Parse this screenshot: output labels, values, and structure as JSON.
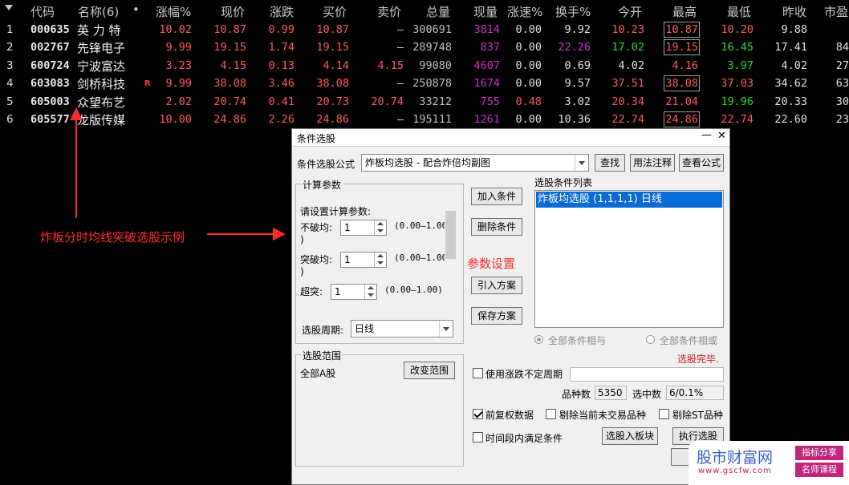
{
  "table": {
    "headers": {
      "code": "代码",
      "name": "名称(6)",
      "change_pct": "涨幅%",
      "price": "现价",
      "change": "涨跌",
      "bid": "买价",
      "ask": "卖价",
      "volume": "总量",
      "cur_volume": "现量",
      "speed": "涨速%",
      "turnover": "换手%",
      "open": "今开",
      "high": "最高",
      "low": "最低",
      "prev_close": "昨收",
      "mcap": "市盈"
    },
    "header_dot": "•",
    "rows": [
      {
        "idx": "1",
        "code": "000635",
        "name": "英 力 特",
        "flag": "",
        "change_pct": "10.02",
        "price": "10.87",
        "change": "0.99",
        "bid": "10.87",
        "ask": "–",
        "volume": "300691",
        "cur_volume": "3814",
        "speed": "0.00",
        "turnover": "9.92",
        "open": "10.23",
        "high": "10.87",
        "low": "10.20",
        "prev_close": "9.88",
        "mcap": ""
      },
      {
        "idx": "2",
        "code": "002767",
        "name": "先锋电子",
        "flag": "",
        "change_pct": "9.99",
        "price": "19.15",
        "change": "1.74",
        "bid": "19.15",
        "ask": "–",
        "volume": "289748",
        "cur_volume": "837",
        "speed": "0.00",
        "turnover": "22.26",
        "open": "17.02",
        "high": "19.15",
        "low": "16.45",
        "prev_close": "17.41",
        "mcap": "84"
      },
      {
        "idx": "3",
        "code": "600724",
        "name": "宁波富达",
        "flag": "",
        "change_pct": "3.23",
        "price": "4.15",
        "change": "0.13",
        "bid": "4.14",
        "ask": "4.15",
        "volume": "99080",
        "cur_volume": "4607",
        "speed": "0.00",
        "turnover": "0.69",
        "open": "4.02",
        "high": "4.16",
        "low": "3.97",
        "prev_close": "4.02",
        "mcap": "27"
      },
      {
        "idx": "4",
        "code": "603083",
        "name": "剑桥科技",
        "flag": "R",
        "change_pct": "9.99",
        "price": "38.08",
        "change": "3.46",
        "bid": "38.08",
        "ask": "–",
        "volume": "250878",
        "cur_volume": "1674",
        "speed": "0.00",
        "turnover": "9.57",
        "open": "37.51",
        "high": "38.08",
        "low": "37.03",
        "prev_close": "34.62",
        "mcap": "63"
      },
      {
        "idx": "5",
        "code": "605003",
        "name": "众望布艺",
        "flag": "",
        "change_pct": "2.02",
        "price": "20.74",
        "change": "0.41",
        "bid": "20.73",
        "ask": "20.74",
        "volume": "33212",
        "cur_volume": "755",
        "speed": "0.48",
        "turnover": "3.02",
        "open": "20.34",
        "high": "21.04",
        "low": "19.96",
        "prev_close": "20.33",
        "mcap": "30"
      },
      {
        "idx": "6",
        "code": "605577",
        "name": "龙版传媒",
        "flag": "",
        "change_pct": "10.00",
        "price": "24.86",
        "change": "2.26",
        "bid": "24.86",
        "ask": "–",
        "volume": "195111",
        "cur_volume": "1261",
        "speed": "0.00",
        "turnover": "10.36",
        "open": "22.74",
        "high": "24.86",
        "low": "22.74",
        "prev_close": "22.60",
        "mcap": "23"
      }
    ]
  },
  "annotations": {
    "left_label": "炸板分时均线突破选股示例",
    "param_label": "参数设置"
  },
  "dialog": {
    "title": "条件选股",
    "min_symbol": "—",
    "close_symbol": "✕",
    "formula_label": "条件选股公式",
    "formula_value": "炸板均选股  -  配合炸倍均副图",
    "btn_find": "查找",
    "btn_usage": "用法注释",
    "btn_view": "查看公式",
    "params_group": "计算参数",
    "params_prompt": "请设置计算参数:",
    "params": [
      {
        "label": "不破均:",
        "value": "1",
        "range": "(0.00—1.00",
        "close": ")"
      },
      {
        "label": "突破均:",
        "value": "1",
        "range": "(0.00—1.00",
        "close": ")"
      },
      {
        "label": "超突:",
        "value": "1",
        "range": "(0.00—1.00)"
      }
    ],
    "period_label": "选股周期:",
    "period_value": "日线",
    "btn_add": "加入条件",
    "btn_delete": "删除条件",
    "btn_import": "引入方案",
    "btn_save": "保存方案",
    "cond_list_label": "选股条件列表",
    "cond_items": [
      "炸板均选股 (1,1,1,1) 日线"
    ],
    "radio_and": "全部条件相与",
    "radio_or": "全部条件相或",
    "status": "选股完毕.",
    "range_group": "选股范围",
    "range_value": "全部A股",
    "btn_change_range": "改变范围",
    "chk_uncertain_period": "使用涨跌不定周期",
    "count_label": "品种数",
    "count_value": "5350",
    "selected_label": "选中数",
    "selected_value": "6/0.1%",
    "chk_fq": "前复权数据",
    "chk_remove_untraded": "剔除当前未交易品种",
    "chk_remove_st": "剔除ST品种",
    "chk_time_range": "时间段内满足条件",
    "btn_to_block": "选股入板块",
    "btn_execute": "执行选股"
  },
  "watermark": {
    "name": "股市财富网",
    "url": "www.gscfw.com",
    "tag1": "指标分享",
    "tag2": "名师课程"
  },
  "colors": {
    "up": "#ff5a5a",
    "down": "#22dd22",
    "annotation": "#ff2a2a",
    "selection": "#0a6ad6"
  }
}
